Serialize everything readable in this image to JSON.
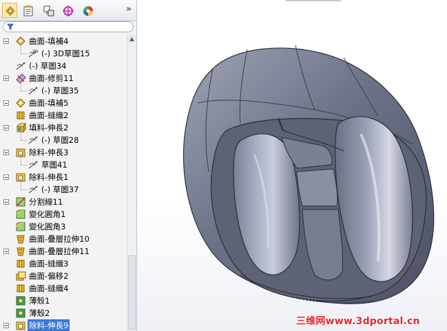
{
  "toolbar": {
    "tabs": [
      {
        "icon": "feature-manager-icon",
        "active": true
      },
      {
        "icon": "property-manager-icon",
        "active": false
      },
      {
        "icon": "configuration-manager-icon",
        "active": false
      },
      {
        "icon": "dimxpert-manager-icon",
        "active": false
      },
      {
        "icon": "display-manager-icon",
        "active": false
      }
    ],
    "expand_label": "»"
  },
  "filter": {
    "icon": "filter-icon"
  },
  "tree": {
    "items": [
      {
        "label": "曲面-填補4",
        "icon": "surface-fill-icon",
        "level": 0,
        "expander": true
      },
      {
        "label": "(-) 3D草圖15",
        "icon": "3d-sketch-icon",
        "level": 1,
        "expander": false
      },
      {
        "label": "(-) 草圖34",
        "icon": "sketch-icon",
        "level": 0,
        "expander": false
      },
      {
        "label": "曲面-修剪11",
        "icon": "surface-trim-icon",
        "level": 0,
        "expander": true
      },
      {
        "label": "(-) 草圖35",
        "icon": "sketch-icon",
        "level": 1,
        "expander": false
      },
      {
        "label": "曲面-填補5",
        "icon": "surface-fill-icon",
        "level": 0,
        "expander": true
      },
      {
        "label": "曲面-縫織2",
        "icon": "surface-knit-icon",
        "level": 0,
        "expander": false
      },
      {
        "label": "填料-伸長2",
        "icon": "boss-extrude-icon",
        "level": 0,
        "expander": true
      },
      {
        "label": "(-) 草圖28",
        "icon": "sketch-icon",
        "level": 1,
        "expander": false
      },
      {
        "label": "除料-伸長3",
        "icon": "cut-extrude-icon",
        "level": 0,
        "expander": true
      },
      {
        "label": "草圖41",
        "icon": "sketch-icon",
        "level": 1,
        "expander": false
      },
      {
        "label": "除料-伸長1",
        "icon": "cut-extrude-icon",
        "level": 0,
        "expander": true
      },
      {
        "label": "(-) 草圖37",
        "icon": "sketch-icon",
        "level": 1,
        "expander": false
      },
      {
        "label": "分割線11",
        "icon": "split-line-icon",
        "level": 0,
        "expander": true
      },
      {
        "label": "變化圓角1",
        "icon": "variable-fillet-icon",
        "level": 0,
        "expander": false
      },
      {
        "label": "變化圓角3",
        "icon": "variable-fillet-icon",
        "level": 0,
        "expander": false
      },
      {
        "label": "曲面-疊層拉伸10",
        "icon": "surface-loft-icon",
        "level": 0,
        "expander": false
      },
      {
        "label": "曲面-疊層拉伸11",
        "icon": "surface-loft-icon",
        "level": 0,
        "expander": true
      },
      {
        "label": "曲面-縫織3",
        "icon": "surface-knit-icon",
        "level": 0,
        "expander": false
      },
      {
        "label": "曲面-偏移2",
        "icon": "surface-offset-icon",
        "level": 0,
        "expander": false
      },
      {
        "label": "曲面-縫織4",
        "icon": "surface-knit-icon",
        "level": 0,
        "expander": false
      },
      {
        "label": "薄殼1",
        "icon": "shell-icon",
        "level": 0,
        "expander": false
      },
      {
        "label": "薄殼2",
        "icon": "shell-icon",
        "level": 0,
        "expander": false
      },
      {
        "label": "除料-伸長9",
        "icon": "cut-extrude-icon",
        "level": 0,
        "expander": true,
        "selected": true
      }
    ]
  },
  "viewport": {
    "model": "computer-mouse-surface-model",
    "watermark": "三维网www.3dportal.cn",
    "watermark_color": "#e8252b",
    "model_color": "#6f7486"
  }
}
